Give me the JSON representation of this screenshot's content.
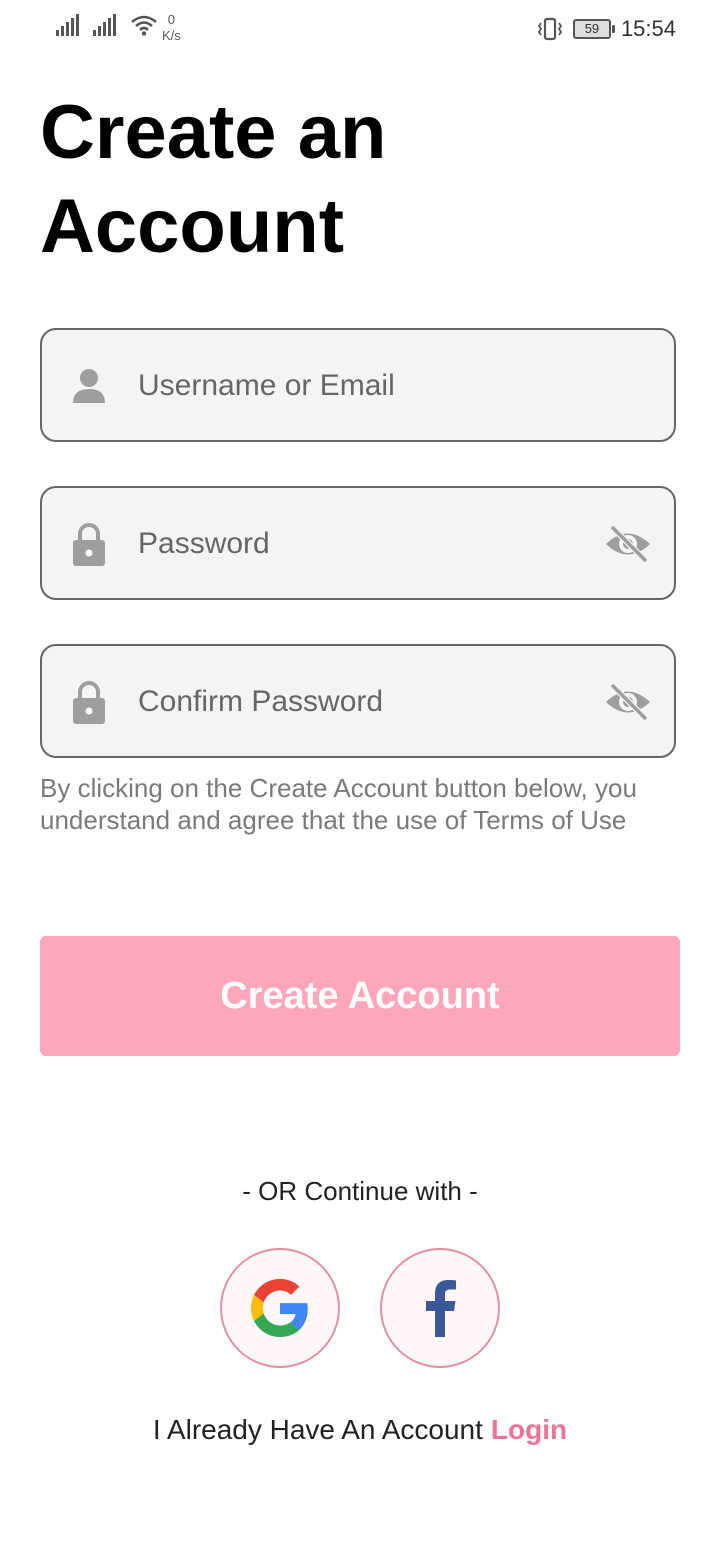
{
  "status_bar": {
    "network_speed_value": "0",
    "network_speed_unit": "K/s",
    "battery_level": "59",
    "time": "15:54"
  },
  "page": {
    "title": "Create an Account"
  },
  "form": {
    "username_placeholder": "Username or Email",
    "password_placeholder": "Password",
    "confirm_password_placeholder": "Confirm Password",
    "terms_text": "By clicking on the Create Account button below, you understand and agree that the use of Terms of Use",
    "submit_label": "Create Account"
  },
  "social": {
    "divider_text": "- OR Continue with -",
    "providers": [
      {
        "name": "google-icon"
      },
      {
        "name": "facebook-icon"
      }
    ]
  },
  "footer": {
    "prompt": "I Already Have An Account",
    "login_label": "Login"
  },
  "colors": {
    "accent": "#ffa6ba",
    "link": "#ef7397",
    "field_bg": "#f4f4f4",
    "facebook_blue": "#3b5998"
  }
}
